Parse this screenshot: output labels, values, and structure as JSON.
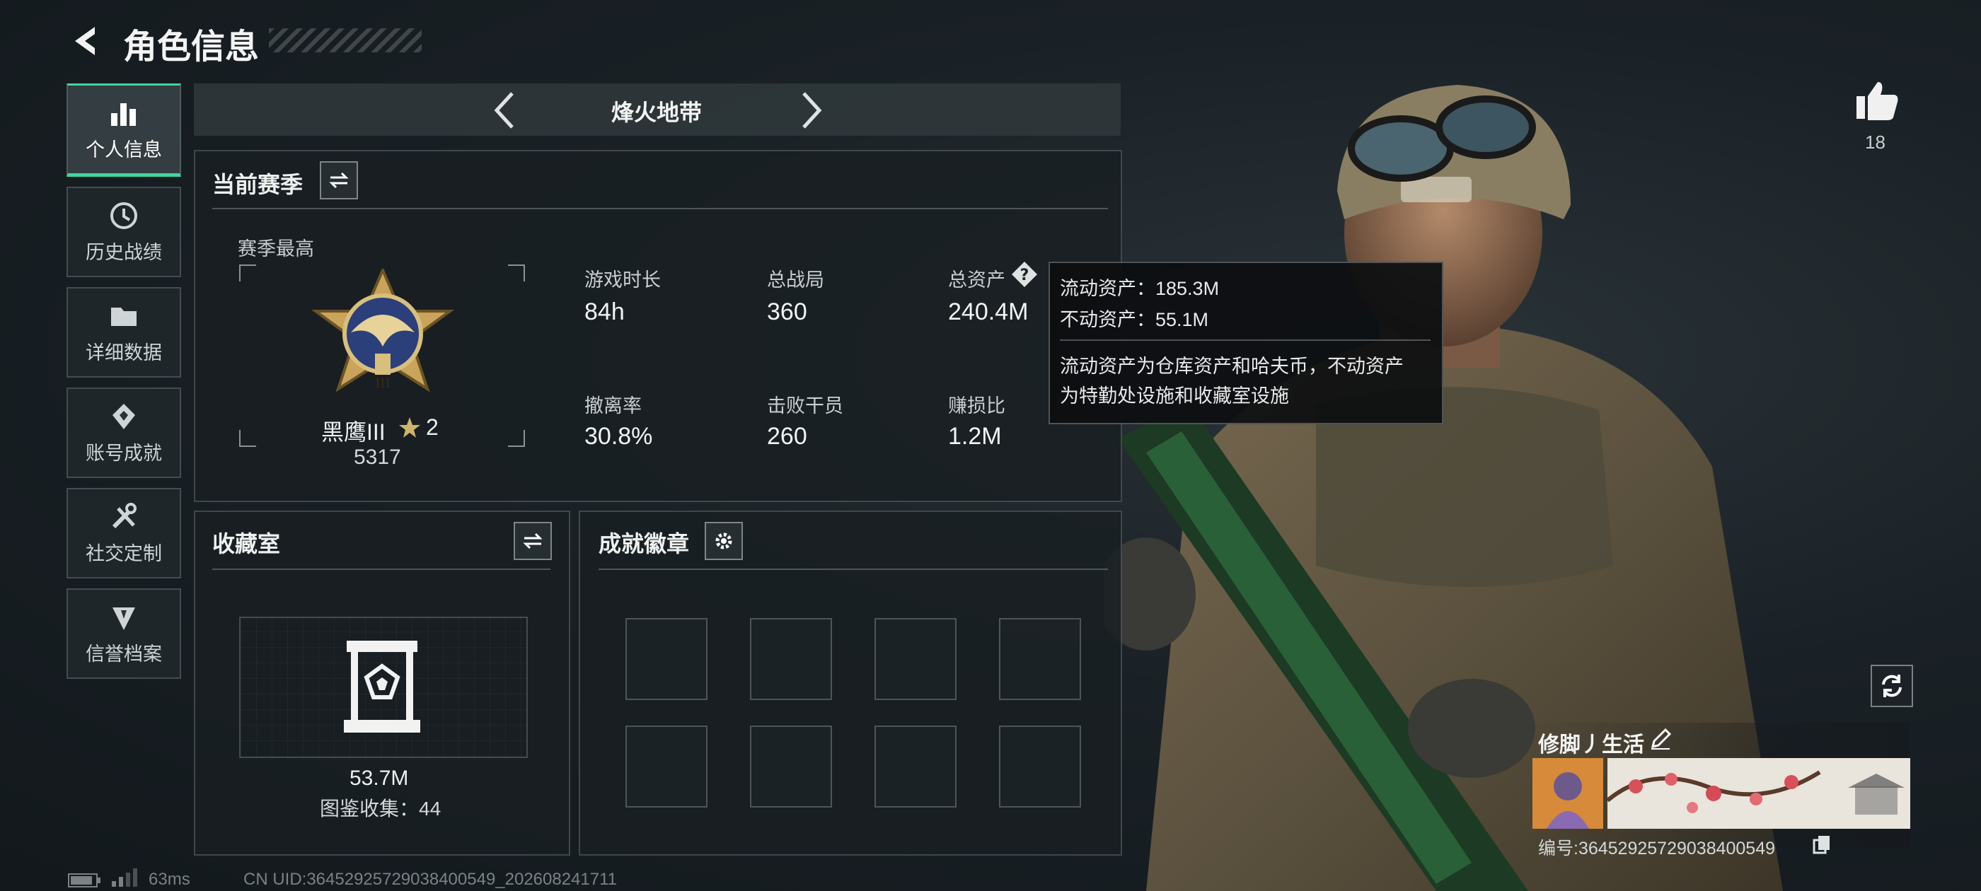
{
  "header": {
    "title": "角色信息"
  },
  "sidebar": {
    "items": [
      {
        "label": "个人信息",
        "icon": "bar-chart-icon",
        "active": true
      },
      {
        "label": "历史战绩",
        "icon": "history-icon",
        "active": false
      },
      {
        "label": "详细数据",
        "icon": "folder-icon",
        "active": false
      },
      {
        "label": "账号成就",
        "icon": "achievement-icon",
        "active": false
      },
      {
        "label": "社交定制",
        "icon": "tools-icon",
        "active": false
      },
      {
        "label": "信誉档案",
        "icon": "shield-icon",
        "active": false
      }
    ]
  },
  "mode_selector": {
    "label": "烽火地带"
  },
  "season": {
    "title": "当前赛季",
    "best_label": "赛季最高",
    "rank_name": "黑鹰III",
    "rank_stars": "2",
    "rank_score": "5317",
    "stats": [
      {
        "label": "游戏时长",
        "value": "84h"
      },
      {
        "label": "总战局",
        "value": "360"
      },
      {
        "label": "总资产",
        "value": "240.4M"
      },
      {
        "label": "撤离率",
        "value": "30.8%"
      },
      {
        "label": "击败干员",
        "value": "260"
      },
      {
        "label": "赚损比",
        "value": "1.2M"
      }
    ]
  },
  "tooltip": {
    "liquid": "流动资产：185.3M",
    "fixed": "不动资产：55.1M",
    "desc_line1": "流动资产为仓库资产和哈夫币，不动资产",
    "desc_line2": "为特勤处设施和收藏室设施"
  },
  "collection": {
    "title": "收藏室",
    "value": "53.7M",
    "count_text": "图鉴收集：44"
  },
  "achievements": {
    "title": "成就徽章",
    "slot_count": 8
  },
  "likes": {
    "count": "18"
  },
  "player": {
    "name": "修脚丿生活",
    "id_text": "编号:3645292572903840054​9"
  },
  "status_bar": {
    "ping": "63ms",
    "uid": "CN UID:364529257290384005​49_202608241711"
  },
  "colors": {
    "accent": "#3fd6a0",
    "panel_bg": "#181e22",
    "text": "#e6e8ea"
  }
}
